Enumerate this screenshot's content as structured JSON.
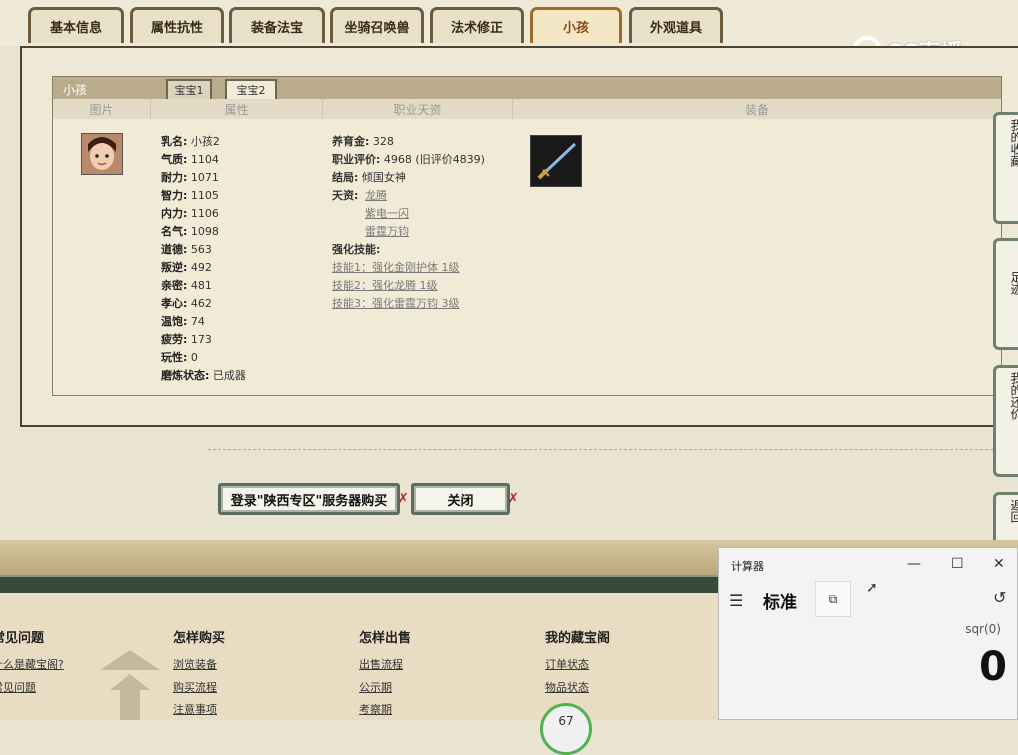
{
  "tabs": [
    "基本信息",
    "属性抗性",
    "装备法宝",
    "坐骑召唤兽",
    "法术修正",
    "小孩",
    "外观道具"
  ],
  "active_tab": "小孩",
  "watermark": "CC直播",
  "panel": {
    "title": "小孩",
    "subtabs": [
      "宝宝1",
      "宝宝2"
    ],
    "active_subtab": "宝宝2",
    "columns": [
      "图片",
      "属性",
      "职业天资",
      "装备"
    ]
  },
  "attributes": [
    {
      "label": "乳名:",
      "value": "小孩2"
    },
    {
      "label": "气质:",
      "value": "1104"
    },
    {
      "label": "耐力:",
      "value": "1071"
    },
    {
      "label": "智力:",
      "value": "1105"
    },
    {
      "label": "内力:",
      "value": "1106"
    },
    {
      "label": "名气:",
      "value": "1098"
    },
    {
      "label": "道德:",
      "value": "563"
    },
    {
      "label": "叛逆:",
      "value": "492"
    },
    {
      "label": "亲密:",
      "value": "481"
    },
    {
      "label": "孝心:",
      "value": "462"
    },
    {
      "label": "温饱:",
      "value": "74"
    },
    {
      "label": "疲劳:",
      "value": "173"
    },
    {
      "label": "玩性:",
      "value": "0"
    },
    {
      "label": "磨炼状态:",
      "value": "已成器"
    }
  ],
  "career": {
    "fund_label": "养育金:",
    "fund": "328",
    "rating_label": "职业评价:",
    "rating": "4968 (旧评价4839)",
    "ending_label": "结局:",
    "ending": "倾国女神",
    "talent_label": "天资:",
    "talents": [
      "龙腾",
      "紫电一闪",
      "雷霆万钧"
    ],
    "skills_label": "强化技能:",
    "skills": [
      "技能1：强化金刚护体 1级",
      "技能2：强化龙腾 1级",
      "技能3：强化雷霆万钧 3级"
    ]
  },
  "buttons": {
    "buy": "登录\"陕西专区\"服务器购买",
    "close": "关闭"
  },
  "side_tabs": [
    "我的收藏",
    "足迹",
    "我的还价",
    "返回"
  ],
  "footer": {
    "columns": [
      {
        "title": "常见问题",
        "links": [
          "什么是藏宝阁?",
          "常见问题"
        ]
      },
      {
        "title": "怎样购买",
        "links": [
          "浏览装备",
          "购买流程",
          "注意事项"
        ]
      },
      {
        "title": "怎样出售",
        "links": [
          "出售流程",
          "公示期",
          "考察期"
        ]
      },
      {
        "title": "我的藏宝阁",
        "links": [
          "订单状态",
          "物品状态"
        ]
      }
    ],
    "badge": "67"
  },
  "calculator": {
    "title": "计算器",
    "mode": "标准",
    "expression": "sqr(0)",
    "display": "0",
    "min_icon": "minimize-icon",
    "max_icon": "maximize-icon",
    "close_icon": "close-icon"
  },
  "colors": {
    "active_tab": "#a06c2a",
    "panel_header": "#b9ab8c",
    "button_border": "#5c6d60"
  }
}
